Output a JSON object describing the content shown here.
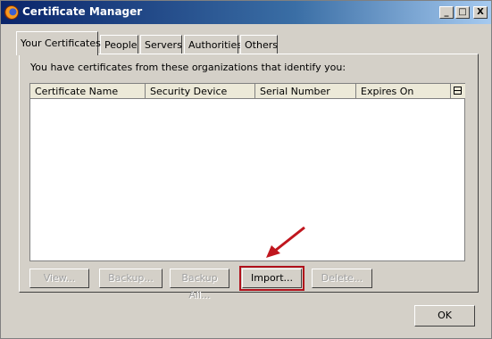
{
  "window": {
    "title": "Certificate Manager",
    "controls": {
      "minimize": "_",
      "maximize": "□",
      "close": "X"
    }
  },
  "tabs": [
    {
      "label": "Your Certificates",
      "active": true
    },
    {
      "label": "People"
    },
    {
      "label": "Servers"
    },
    {
      "label": "Authorities"
    },
    {
      "label": "Others"
    }
  ],
  "panel": {
    "intro": "You have certificates from these organizations that identify you:",
    "columns": [
      "Certificate Name",
      "Security Device",
      "Serial Number",
      "Expires On"
    ],
    "rows": []
  },
  "buttons": {
    "view": "View...",
    "backup": "Backup...",
    "backup_all": "Backup All...",
    "import": "Import...",
    "delete": "Delete...",
    "ok": "OK"
  },
  "annotation": {
    "highlight_color": "#b0111b",
    "arrow_color": "#c0161e"
  },
  "icons": {
    "app": "firefox-icon",
    "column_picker": "column-picker-icon"
  }
}
